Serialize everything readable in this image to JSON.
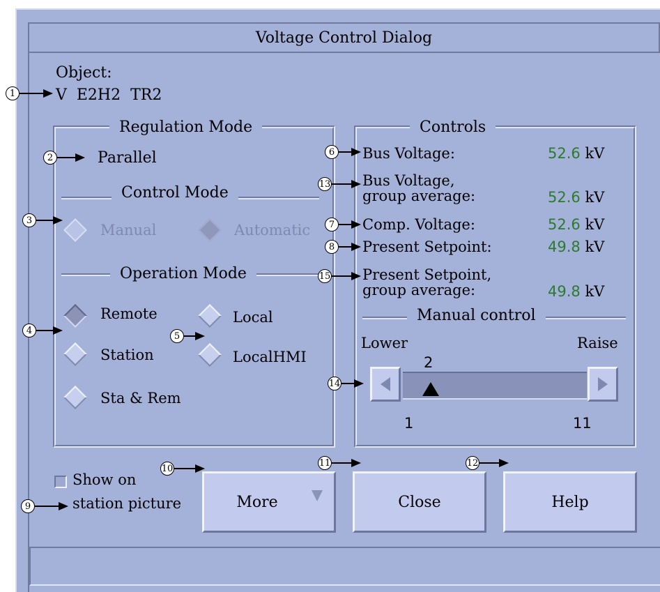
{
  "window": {
    "title": "Voltage Control Dialog"
  },
  "object": {
    "label": "Object:",
    "value": "V  E2H2  TR2"
  },
  "regulation": {
    "title": "Regulation Mode",
    "mode_value": "Parallel",
    "control_mode_title": "Control Mode",
    "control_options": [
      "Manual",
      "Automatic"
    ],
    "control_selected": "Automatic",
    "operation_mode_title": "Operation Mode",
    "operation_options": [
      "Remote",
      "Station",
      "Sta & Rem",
      "Local",
      "LocalHMI"
    ],
    "operation_selected": "Remote"
  },
  "controls": {
    "title": "Controls",
    "rows": [
      {
        "label": "Bus Voltage:",
        "value": "52.6",
        "unit": "kV"
      },
      {
        "label": "Bus Voltage,",
        "label2": "group average:",
        "value": "52.6",
        "unit": "kV"
      },
      {
        "label": "Comp. Voltage:",
        "value": "52.6",
        "unit": "kV"
      },
      {
        "label": "Present Setpoint:",
        "value": "49.8",
        "unit": "kV"
      },
      {
        "label": "Present Setpoint,",
        "label2": "group average:",
        "value": "49.8",
        "unit": "kV"
      }
    ],
    "manual_title": "Manual control",
    "lower_label": "Lower",
    "raise_label": "Raise",
    "tap_current": "2",
    "tap_min": "1",
    "tap_max": "11"
  },
  "bottom": {
    "checkbox_label_1": "Show on",
    "checkbox_label_2": "station picture",
    "more_label": "More",
    "close_label": "Close",
    "help_label": "Help"
  },
  "callouts": [
    "1",
    "2",
    "3",
    "4",
    "5",
    "6",
    "7",
    "8",
    "9",
    "10",
    "11",
    "12",
    "13",
    "14",
    "15"
  ],
  "colors": {
    "dialog_bg": "#a4b1d9",
    "value_green": "#2d7a2d",
    "disabled_text": "#8089ad"
  }
}
